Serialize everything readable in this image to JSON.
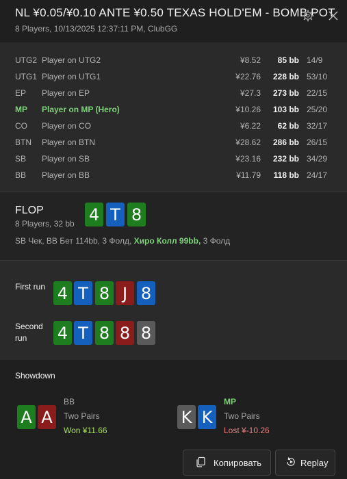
{
  "colors": {
    "green": "#1e7d1e",
    "blue": "#1560bd",
    "red": "#8b1c1c",
    "grey": "#5a5a5a",
    "hero": "#7fd07a",
    "win": "#a8e05f",
    "loss": "#e88080"
  },
  "header": {
    "title": "NL ¥0.05/¥0.10 ANTE ¥0.50 TEXAS HOLD'EM - BOMB POT",
    "subtitle": "8 Players, 10/13/2025 12:37:11 PM, ClubGG",
    "settings_icon": "gear-icon",
    "close_icon": "close-icon"
  },
  "players": [
    {
      "pos": "UTG2",
      "name": "Player on UTG2",
      "stack": "¥8.52",
      "bb": "85 bb",
      "stats": "14/9",
      "hero": false
    },
    {
      "pos": "UTG1",
      "name": "Player on UTG1",
      "stack": "¥22.76",
      "bb": "228 bb",
      "stats": "53/10",
      "hero": false
    },
    {
      "pos": "EP",
      "name": "Player on EP",
      "stack": "¥27.3",
      "bb": "273 bb",
      "stats": "22/15",
      "hero": false
    },
    {
      "pos": "MP",
      "name": "Player on MP (Hero)",
      "stack": "¥10.26",
      "bb": "103 bb",
      "stats": "25/20",
      "hero": true
    },
    {
      "pos": "CO",
      "name": "Player on CO",
      "stack": "¥6.22",
      "bb": "62 bb",
      "stats": "32/17",
      "hero": false
    },
    {
      "pos": "BTN",
      "name": "Player on BTN",
      "stack": "¥28.62",
      "bb": "286 bb",
      "stats": "26/15",
      "hero": false
    },
    {
      "pos": "SB",
      "name": "Player on SB",
      "stack": "¥23.16",
      "bb": "232 bb",
      "stats": "34/29",
      "hero": false
    },
    {
      "pos": "BB",
      "name": "Player on BB",
      "stack": "¥11.79",
      "bb": "118 bb",
      "stats": "24/17",
      "hero": false
    }
  ],
  "flop": {
    "title": "FLOP",
    "subtitle": "8 Players, 32 bb",
    "cards": [
      {
        "rank": "4",
        "suit": "green"
      },
      {
        "rank": "T",
        "suit": "blue"
      },
      {
        "rank": "8",
        "suit": "green"
      }
    ],
    "actions_pre": "SB Чек, BB Бет 114bb, 3 Фолд, ",
    "actions_hero": "Хиро Колл 99bb,",
    "actions_post": " 3 Фолд"
  },
  "runs": [
    {
      "label": "First run",
      "cards": [
        {
          "rank": "4",
          "suit": "green"
        },
        {
          "rank": "T",
          "suit": "blue"
        },
        {
          "rank": "8",
          "suit": "green"
        },
        {
          "rank": "J",
          "suit": "red"
        },
        {
          "rank": "8",
          "suit": "blue"
        }
      ]
    },
    {
      "label": "Second run",
      "cards": [
        {
          "rank": "4",
          "suit": "green"
        },
        {
          "rank": "T",
          "suit": "blue"
        },
        {
          "rank": "8",
          "suit": "green"
        },
        {
          "rank": "8",
          "suit": "red"
        },
        {
          "rank": "8",
          "suit": "grey"
        }
      ]
    }
  ],
  "showdown": {
    "title": "Showdown",
    "hands": [
      {
        "player": "BB",
        "hand": "Two Pairs",
        "result": "Won ¥11.66",
        "outcome": "win",
        "cards": [
          {
            "rank": "A",
            "suit": "green"
          },
          {
            "rank": "A",
            "suit": "red"
          }
        ]
      },
      {
        "player": "MP",
        "hand": "Two Pairs",
        "result": "Lost ¥-10.26",
        "outcome": "loss",
        "cards": [
          {
            "rank": "K",
            "suit": "grey"
          },
          {
            "rank": "K",
            "suit": "blue"
          }
        ]
      }
    ]
  },
  "footer": {
    "copy_label": "Копировать",
    "copy_icon": "copy-icon",
    "replay_label": "Replay",
    "replay_icon": "replay-icon"
  }
}
